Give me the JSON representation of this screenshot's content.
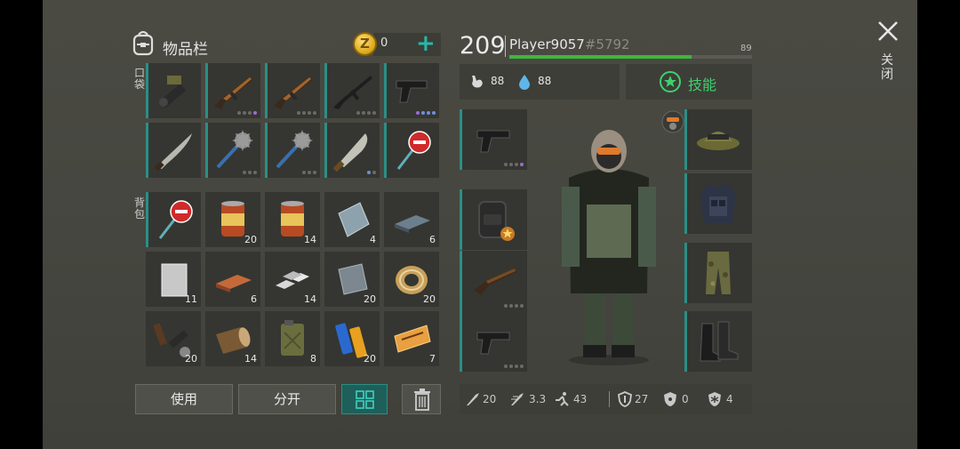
{
  "header": {
    "title": "物品栏",
    "coins": "0",
    "add": "+"
  },
  "labels": {
    "pockets": "口袋",
    "backpack": "背包"
  },
  "pocket_items": [
    {
      "name": "grenade-launcher-icon",
      "dots": ""
    },
    {
      "name": "ak-rifle-icon",
      "dots": "gggp"
    },
    {
      "name": "ak-rifle-icon",
      "dots": "gggg"
    },
    {
      "name": "m16-rifle-icon",
      "dots": "gggg"
    },
    {
      "name": "pistol-icon",
      "dots": "pbbb"
    },
    {
      "name": "machete-icon",
      "dots": ""
    },
    {
      "name": "spiked-mace-icon",
      "dots": "ggg"
    },
    {
      "name": "spiked-mace-icon",
      "dots": "ggg"
    },
    {
      "name": "cleaver-icon",
      "dots": "bg"
    },
    {
      "name": "stop-sign-icon",
      "dots": ""
    }
  ],
  "backpack_items": [
    {
      "name": "stop-sign-icon",
      "count": ""
    },
    {
      "name": "food-can-icon",
      "count": "20"
    },
    {
      "name": "food-can-icon",
      "count": "14"
    },
    {
      "name": "metal-plate-icon",
      "count": "4"
    },
    {
      "name": "iron-bar-icon",
      "count": "6"
    },
    {
      "name": "aluminum-sheet-icon",
      "count": "11"
    },
    {
      "name": "copper-bar-icon",
      "count": "6"
    },
    {
      "name": "tin-bars-icon",
      "count": "14"
    },
    {
      "name": "steel-plate-icon",
      "count": "20"
    },
    {
      "name": "wire-spool-icon",
      "count": "20"
    },
    {
      "name": "weapon-parts-icon",
      "count": "20"
    },
    {
      "name": "log-icon",
      "count": "14"
    },
    {
      "name": "jerrycan-icon",
      "count": "8"
    },
    {
      "name": "batteries-icon",
      "count": "20"
    },
    {
      "name": "coupon-icon",
      "count": "7"
    }
  ],
  "buttons": {
    "use": "使用",
    "split": "分开"
  },
  "player": {
    "level": "209",
    "name": "Player9057",
    "tag": "#5792",
    "xp": "89",
    "xp_fraction": 0.75
  },
  "stats": {
    "hunger": "88",
    "water": "88",
    "skills": "技能"
  },
  "bottom_stats": {
    "melee": "20",
    "speed": "3.3",
    "run": "43",
    "armor": "27",
    "radiation": "0",
    "cold": "4"
  },
  "close": {
    "label": "关闭"
  }
}
